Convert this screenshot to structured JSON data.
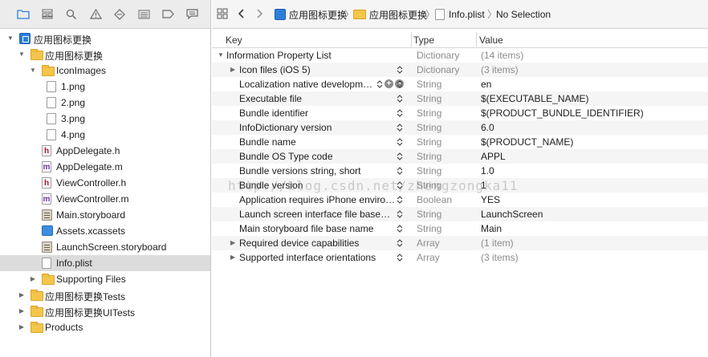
{
  "navigator": {
    "tree": [
      {
        "label": "应用图标更换",
        "icon": "project-icon",
        "disclosure": "open",
        "level": 0
      },
      {
        "label": "应用图标更换",
        "icon": "folder-icon",
        "disclosure": "open",
        "level": 1
      },
      {
        "label": "IconImages",
        "icon": "folder-icon",
        "disclosure": "open",
        "level": 2
      },
      {
        "label": "1.png",
        "icon": "png-file-icon",
        "disclosure": "",
        "level": 3
      },
      {
        "label": "2.png",
        "icon": "png-file-icon",
        "disclosure": "",
        "level": 3
      },
      {
        "label": "3.png",
        "icon": "png-file-icon",
        "disclosure": "",
        "level": 3
      },
      {
        "label": "4.png",
        "icon": "png-file-icon",
        "disclosure": "",
        "level": 3
      },
      {
        "label": "AppDelegate.h",
        "icon": "header-file-icon",
        "disclosure": "",
        "level": 2
      },
      {
        "label": "AppDelegate.m",
        "icon": "objc-file-icon",
        "disclosure": "",
        "level": 2
      },
      {
        "label": "ViewController.h",
        "icon": "header-file-icon",
        "disclosure": "",
        "level": 2
      },
      {
        "label": "ViewController.m",
        "icon": "objc-file-icon",
        "disclosure": "",
        "level": 2
      },
      {
        "label": "Main.storyboard",
        "icon": "storyboard-file-icon",
        "disclosure": "",
        "level": 2
      },
      {
        "label": "Assets.xcassets",
        "icon": "asset-catalog-icon",
        "disclosure": "",
        "level": 2
      },
      {
        "label": "LaunchScreen.storyboard",
        "icon": "storyboard-file-icon",
        "disclosure": "",
        "level": 2
      },
      {
        "label": "Info.plist",
        "icon": "plist-file-icon",
        "disclosure": "",
        "level": 2,
        "selected": true
      },
      {
        "label": "Supporting Files",
        "icon": "folder-icon",
        "disclosure": "closed",
        "level": 2
      },
      {
        "label": "应用图标更换Tests",
        "icon": "folder-icon",
        "disclosure": "closed",
        "level": 1
      },
      {
        "label": "应用图标更换UITests",
        "icon": "folder-icon",
        "disclosure": "closed",
        "level": 1
      },
      {
        "label": "Products",
        "icon": "folder-icon",
        "disclosure": "closed",
        "level": 1
      }
    ]
  },
  "jumpbar": {
    "project": "应用图标更换",
    "group": "应用图标更换",
    "file": "Info.plist",
    "selection": "No Selection"
  },
  "plist": {
    "headers": {
      "key": "Key",
      "type": "Type",
      "value": "Value"
    },
    "rows": [
      {
        "key": "Information Property List",
        "type": "Dictionary",
        "value": "(14 items)",
        "disclosure": "open",
        "indent": 0,
        "value_gray": true
      },
      {
        "key": "Icon files (iOS 5)",
        "type": "Dictionary",
        "value": "(3 items)",
        "disclosure": "closed",
        "indent": 1,
        "value_gray": true
      },
      {
        "key": "Localization native developm…",
        "type": "String",
        "value": "en",
        "disclosure": "",
        "indent": 1,
        "controls": true
      },
      {
        "key": "Executable file",
        "type": "String",
        "value": "$(EXECUTABLE_NAME)",
        "disclosure": "",
        "indent": 1
      },
      {
        "key": "Bundle identifier",
        "type": "String",
        "value": "$(PRODUCT_BUNDLE_IDENTIFIER)",
        "disclosure": "",
        "indent": 1
      },
      {
        "key": "InfoDictionary version",
        "type": "String",
        "value": "6.0",
        "disclosure": "",
        "indent": 1
      },
      {
        "key": "Bundle name",
        "type": "String",
        "value": "$(PRODUCT_NAME)",
        "disclosure": "",
        "indent": 1
      },
      {
        "key": "Bundle OS Type code",
        "type": "String",
        "value": "APPL",
        "disclosure": "",
        "indent": 1
      },
      {
        "key": "Bundle versions string, short",
        "type": "String",
        "value": "1.0",
        "disclosure": "",
        "indent": 1
      },
      {
        "key": "Bundle version",
        "type": "String",
        "value": "1",
        "disclosure": "",
        "indent": 1
      },
      {
        "key": "Application requires iPhone enviro…",
        "type": "Boolean",
        "value": "YES",
        "disclosure": "",
        "indent": 1
      },
      {
        "key": "Launch screen interface file base…",
        "type": "String",
        "value": "LaunchScreen",
        "disclosure": "",
        "indent": 1
      },
      {
        "key": "Main storyboard file base name",
        "type": "String",
        "value": "Main",
        "disclosure": "",
        "indent": 1
      },
      {
        "key": "Required device capabilities",
        "type": "Array",
        "value": "(1 item)",
        "disclosure": "closed",
        "indent": 1,
        "value_gray": true
      },
      {
        "key": "Supported interface orientations",
        "type": "Array",
        "value": "(3 items)",
        "disclosure": "closed",
        "indent": 1,
        "value_gray": true
      }
    ]
  },
  "watermark": "http://blog.csdn.net/zhengzongka11",
  "colors": {
    "accent": "#2e7ed8",
    "folder": "#f5c54b",
    "selected_row": "#dcdcdc"
  }
}
